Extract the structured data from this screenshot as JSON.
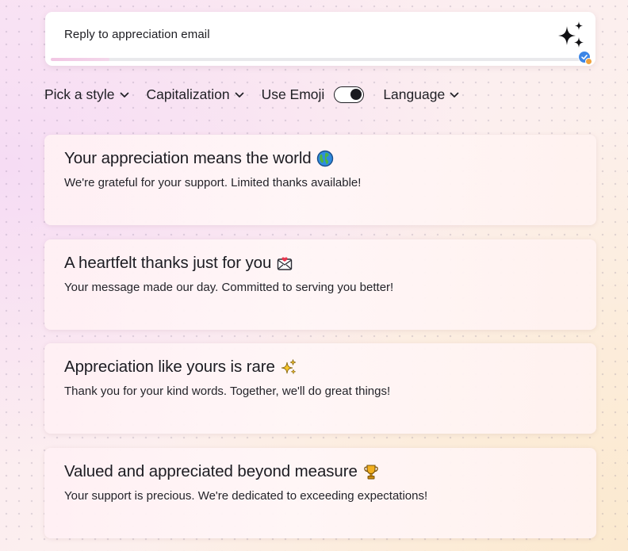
{
  "prompt": {
    "text": "Reply to appreciation email",
    "progress": 0.11
  },
  "toolbar": {
    "style_label": "Pick a style",
    "capitalization_label": "Capitalization",
    "emoji_label": "Use Emoji",
    "emoji_enabled": true,
    "language_label": "Language"
  },
  "suggestions": [
    {
      "title": "Your appreciation means the world",
      "emoji": "globe-emoji",
      "body": "We're grateful for your support. Limited thanks available!"
    },
    {
      "title": "A heartfelt thanks just for you",
      "emoji": "love-letter-emoji",
      "body": "Your message made our day. Committed to serving you better!"
    },
    {
      "title": "Appreciation like yours is rare",
      "emoji": "sparkles-emoji",
      "body": "Thank you for your kind words. Together, we'll do great things!"
    },
    {
      "title": "Valued and appreciated beyond measure",
      "emoji": "trophy-emoji",
      "body": "Your support is precious. We're dedicated to exceeding expectations!"
    }
  ],
  "colors": {
    "accent_blue": "#3d86e6",
    "badge_orange": "#f0a23c",
    "progress_pink": "#f2c6e4"
  }
}
